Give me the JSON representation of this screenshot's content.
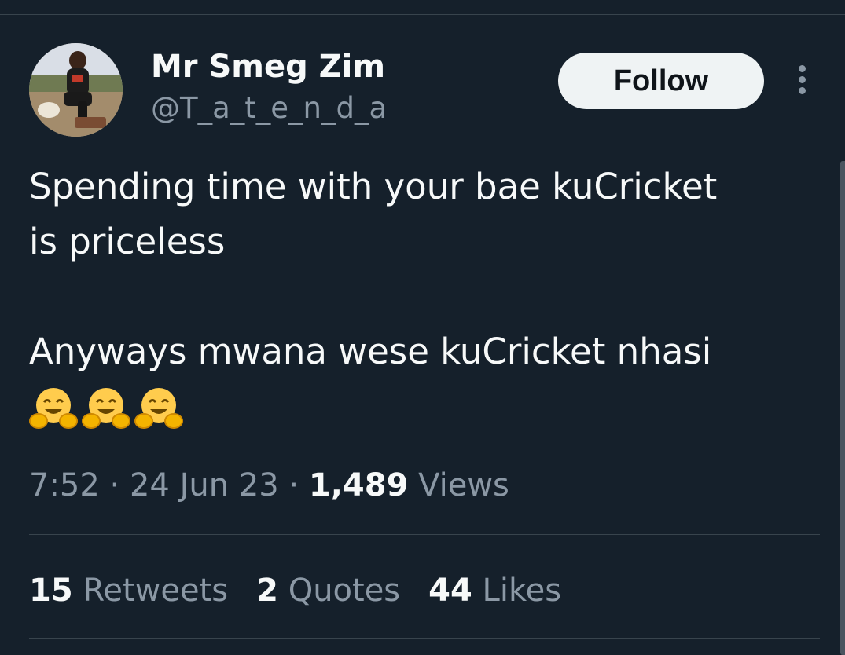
{
  "tweet": {
    "author_name": "Mr Smeg Zim",
    "author_handle": "@T_a_t_e_n_d_a",
    "follow_label": "Follow",
    "lines": [
      "Spending time with your bae kuCricket",
      "is priceless",
      "Anyways mwana wese kuCricket nhasi"
    ],
    "emojis": [
      "hugging-face",
      "hugging-face",
      "hugging-face"
    ],
    "time": "7:52",
    "date": "24 Jun 23",
    "views_count": "1,489",
    "views_label": "Views",
    "stats": [
      {
        "count": "15",
        "label": "Retweets"
      },
      {
        "count": "2",
        "label": "Quotes"
      },
      {
        "count": "44",
        "label": "Likes"
      }
    ]
  },
  "colors": {
    "background": "#15202b",
    "text_primary": "#f7f9f9",
    "text_secondary": "#8b98a5",
    "divider": "#38444d",
    "follow_button": "#eff3f4"
  }
}
